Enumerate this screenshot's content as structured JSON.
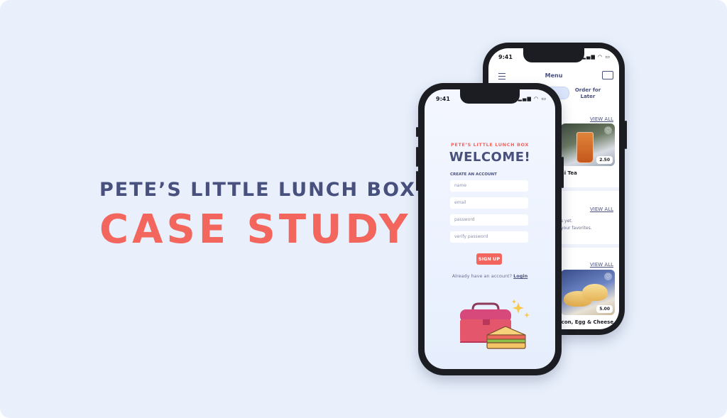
{
  "headline": {
    "line1": "PETE’S LITTLE LUNCH BOX:",
    "line2": "CASE STUDY"
  },
  "colors": {
    "background": "#e9f0fc",
    "navy": "#48507e",
    "coral": "#f2665d"
  },
  "back_phone": {
    "time": "9:41",
    "status_icons": "▂▄▆ ◠ ▭",
    "title": "Menu",
    "menu_icon": "hamburger-icon",
    "cart_icon": "lunchbox-icon",
    "order_for_later": "Order for Later",
    "sections": [
      {
        "view_all": "VIEW ALL",
        "item": "ai Tea",
        "price": "2.50"
      },
      {
        "view_all": "VIEW ALL",
        "empty_line1": "s yet.",
        "empty_line2": "your favorites."
      },
      {
        "view_all": "VIEW ALL",
        "item": "acon, Egg & Cheese",
        "price": "5.00"
      }
    ]
  },
  "front_phone": {
    "time": "9:41",
    "status_icons": "▂▄▆ ◠ ▭",
    "brand": "PETE’S LITTLE LUNCH BOX",
    "welcome": "WELCOME!",
    "create_account": "CREATE AN ACCOUNT",
    "fields": {
      "name": "name",
      "email": "email",
      "password": "password",
      "verify": "verify password"
    },
    "signup": "SIGN UP",
    "already_text": "Already have an account?",
    "login": "Login"
  }
}
